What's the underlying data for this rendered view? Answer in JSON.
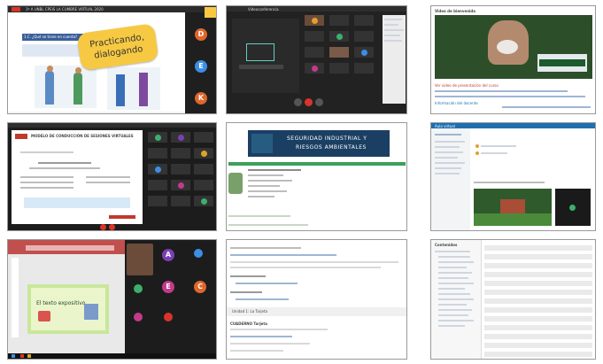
{
  "panel1": {
    "tab_title": "1º A UNBL CPEIS LA CUMBRE VIRTUAL 2020",
    "slide_heading": "1.C. ¿Qué se tiene en cuenta?",
    "bubble_text_line1": "Practicando,",
    "bubble_text_line2": "dialogando",
    "participants": [
      "D",
      "E",
      "K"
    ],
    "colors": {
      "D": "#e0662a",
      "E": "#3c8ee6",
      "K": "#e0662a"
    }
  },
  "panel2": {
    "top_label": "Videoconferencia",
    "colors": {
      "end_call": "#d9342b"
    }
  },
  "panel3": {
    "header": "Video de bienvenida",
    "banner_title": "SEGURIDAD INDUSTRIAL Y RIESGOS AMBIENTALES",
    "links": [
      "Ver video de presentación del curso",
      "Información del docente"
    ]
  },
  "panel4": {
    "doc_title": "MODELO DE CONDUCCIÓN DE SESIONES VIRTUALES",
    "colors": {
      "brand": "#c0392b"
    }
  },
  "panel5": {
    "banner_title_line1": "SEGURIDAD INDUSTRIAL Y",
    "banner_title_line2": "RIESGOS AMBIENTALES",
    "colors": {
      "banner": "#1a3f63"
    }
  },
  "panel6": {
    "site_title": "Aula virtual",
    "colors": {
      "header": "#1e6fb0"
    }
  },
  "panel7": {
    "slide_title": "El texto expositivo",
    "participants": [
      "A",
      "E",
      "C"
    ],
    "colors": {
      "A": "#7b3fb3",
      "E": "#c33a8a",
      "C": "#e0662a",
      "ribbon": "#c0504d"
    }
  },
  "panel8": {
    "section_title": "Unidad 1: La Tarjeta",
    "subheading": "CUADERNO Tarjeta"
  },
  "panel9": {
    "sidebar_label": "Contenidos"
  }
}
